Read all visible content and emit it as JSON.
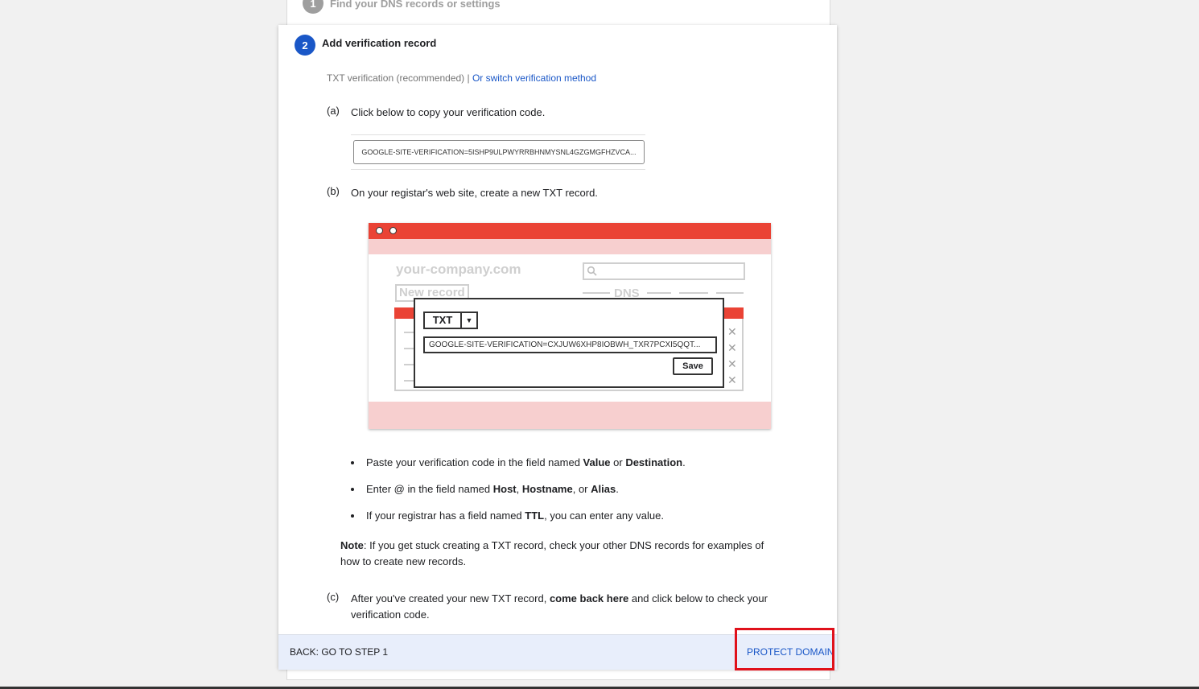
{
  "step1": {
    "number": "1",
    "title": "Find your DNS records or settings"
  },
  "step2": {
    "number": "2",
    "title": "Add verification record",
    "method_text": "TXT verification (recommended) |",
    "switch_link": "Or switch verification method",
    "a": {
      "label": "(a)",
      "text": "Click below to copy your verification code."
    },
    "code": "GOOGLE-SITE-VERIFICATION=5ISHP9ULPWYRRBHNMYSNL4GZGMGFHZVCA...",
    "b": {
      "label": "(b)",
      "text": "On your registar's web site, create a new TXT record."
    },
    "illustration": {
      "domain": "your-company.com",
      "new_record": "New record",
      "dns_label": "DNS",
      "record_type": "TXT",
      "dropdown_arrow": "▼",
      "value": "GOOGLE-SITE-VERIFICATION=CXJUW6XHP8IOBWH_TXR7PCXI5QQT...",
      "save": "Save",
      "close_marks": [
        "✕",
        "✕",
        "✕",
        "✕"
      ]
    },
    "bullets": [
      {
        "p1": "Paste your verification code in the field named ",
        "b1": "Value",
        "p2": " or ",
        "b2": "Destination",
        "p3": "."
      },
      {
        "p1": "Enter @ in the field named ",
        "b1": "Host",
        "p2": ", ",
        "b2": "Hostname",
        "p3": ", or ",
        "b3": "Alias",
        "p4": "."
      },
      {
        "p1": "If your registrar has a field named ",
        "b1": "TTL",
        "p2": ", you can enter any value."
      }
    ],
    "note": {
      "label": "Note",
      "text": ": If you get stuck creating a TXT record, check your other DNS records for examples of how to create new records."
    },
    "c": {
      "label": "(c)",
      "p1": "After you've created your new TXT record, ",
      "bold": "come back here",
      "p2": " and click below to check your verification code."
    }
  },
  "footer": {
    "back": "BACK: GO TO STEP 1",
    "protect": "PROTECT DOMAIN"
  },
  "colors": {
    "accent": "#1a57c7",
    "highlight": "#e0111b",
    "illustration_red": "#ea4335"
  }
}
